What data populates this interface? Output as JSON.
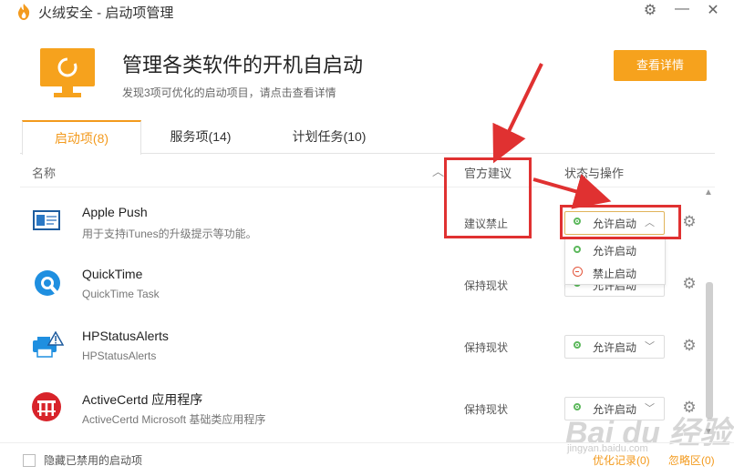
{
  "app": {
    "title": "火绒安全 - 启动项管理"
  },
  "header": {
    "title": "管理各类软件的开机自启动",
    "subtitle": "发现3项可优化的启动项目，请点击查看详情",
    "details_button": "查看详情"
  },
  "tabs": [
    {
      "label": "启动项(8)",
      "active": true
    },
    {
      "label": "服务项(14)",
      "active": false
    },
    {
      "label": "计划任务(10)",
      "active": false
    }
  ],
  "columns": {
    "name": "名称",
    "advice": "官方建议",
    "status": "状态与操作"
  },
  "rows": [
    {
      "name": "Apple Push",
      "desc": "用于支持iTunes的升级提示等功能。",
      "advice": "建议禁止",
      "status": "允许启动"
    },
    {
      "name": "QuickTime",
      "desc": "QuickTime Task",
      "advice": "保持现状",
      "status": "允许启动"
    },
    {
      "name": "HPStatusAlerts",
      "desc": "HPStatusAlerts",
      "advice": "保持现状",
      "status": "允许启动"
    },
    {
      "name": "ActiveCertd 应用程序",
      "desc": "ActiveCertd Microsoft 基础类应用程序",
      "advice": "保持现状",
      "status": "允许启动"
    }
  ],
  "dropdown": {
    "options": [
      "允许启动",
      "禁止启动"
    ]
  },
  "footer": {
    "hide_label": "隐藏已禁用的启动项",
    "opt_log": "优化记录(0)",
    "ignore_area": "忽略区(0)"
  },
  "watermark": {
    "text": "Bai du 经验",
    "sub": "jingyan.baidu.com"
  },
  "colors": {
    "accent": "#f39a1d",
    "annotation": "#e03131",
    "allow": "#5cb85c",
    "forbid": "#e3553b"
  }
}
